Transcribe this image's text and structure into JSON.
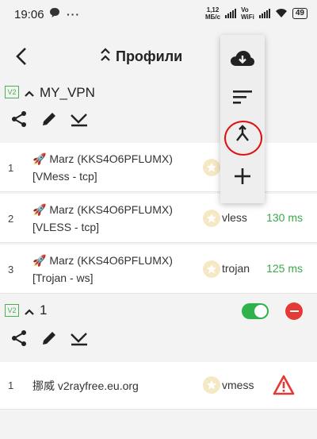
{
  "status_bar": {
    "time": "19:06",
    "speed_value": "1,12",
    "speed_unit": "МБ/с",
    "volte_top": "Vo",
    "volte_bottom": "WiFi",
    "battery": "49"
  },
  "toolbar": {
    "title": "Профили"
  },
  "groups": [
    {
      "badge": "V2",
      "name": "MY_VPN",
      "items": [
        {
          "num": "1",
          "name_line1": "🚀 Marz (KKS4O6PFLUMX)",
          "name_line2": "[VMess - tcp]",
          "protocol": "",
          "ping": ""
        },
        {
          "num": "2",
          "name_line1": "🚀 Marz (KKS4O6PFLUMX)",
          "name_line2": "[VLESS - tcp]",
          "protocol": "vless",
          "ping": "130 ms"
        },
        {
          "num": "3",
          "name_line1": "🚀 Marz (KKS4O6PFLUMX)",
          "name_line2": "[Trojan - ws]",
          "protocol": "trojan",
          "ping": "125 ms"
        }
      ]
    },
    {
      "badge": "V2",
      "name": "1",
      "enabled": true,
      "items": [
        {
          "num": "1",
          "name_line1": "挪威 v2rayfree.eu.org",
          "protocol": "vmess",
          "warning": true
        }
      ]
    }
  ],
  "menu": {
    "items": [
      "cloud-download-icon",
      "sort-icon",
      "merge-icon",
      "add-icon"
    ]
  },
  "colors": {
    "accent_green": "#2db34a",
    "ping_green": "#3aa84a",
    "danger_red": "#e53935"
  }
}
